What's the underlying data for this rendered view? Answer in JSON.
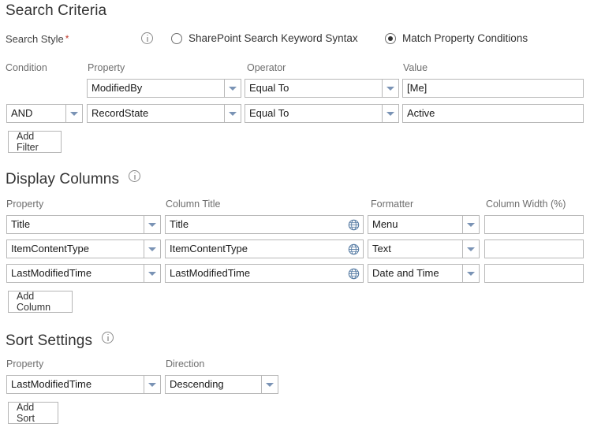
{
  "search_criteria": {
    "heading": "Search Criteria",
    "search_style": {
      "label": "Search Style",
      "required_marker": "*",
      "info_icon": "info-icon",
      "options": [
        {
          "label": "SharePoint Search Keyword Syntax",
          "selected": false
        },
        {
          "label": "Match Property Conditions",
          "selected": true
        }
      ]
    },
    "columns": {
      "condition": "Condition",
      "property": "Property",
      "operator": "Operator",
      "value": "Value"
    },
    "rows": [
      {
        "condition": "",
        "property": "ModifiedBy",
        "operator": "Equal To",
        "value": "[Me]"
      },
      {
        "condition": "AND",
        "property": "RecordState",
        "operator": "Equal To",
        "value": "Active"
      }
    ],
    "add_filter_label": "Add Filter"
  },
  "display_columns": {
    "heading": "Display Columns",
    "info_icon": "info-icon",
    "columns": {
      "property": "Property",
      "column_title": "Column Title",
      "formatter": "Formatter",
      "column_width": "Column Width (%)"
    },
    "rows": [
      {
        "property": "Title",
        "column_title": "Title",
        "globe_icon": "globe-icon",
        "formatter": "Menu",
        "column_width": ""
      },
      {
        "property": "ItemContentType",
        "column_title": "ItemContentType",
        "globe_icon": "globe-icon",
        "formatter": "Text",
        "column_width": ""
      },
      {
        "property": "LastModifiedTime",
        "column_title": "LastModifiedTime",
        "globe_icon": "globe-icon",
        "formatter": "Date and Time",
        "column_width": ""
      }
    ],
    "add_column_label": "Add Column"
  },
  "sort_settings": {
    "heading": "Sort Settings",
    "info_icon": "info-icon",
    "columns": {
      "property": "Property",
      "direction": "Direction"
    },
    "rows": [
      {
        "property": "LastModifiedTime",
        "direction": "Descending"
      }
    ],
    "add_sort_label": "Add Sort"
  },
  "colors": {
    "text": "#333333",
    "label": "#6e6e6e",
    "border": "#b8b8b8",
    "arrow": "#7a93b5",
    "required": "#c0392b",
    "globe": "#5b7fa6"
  }
}
